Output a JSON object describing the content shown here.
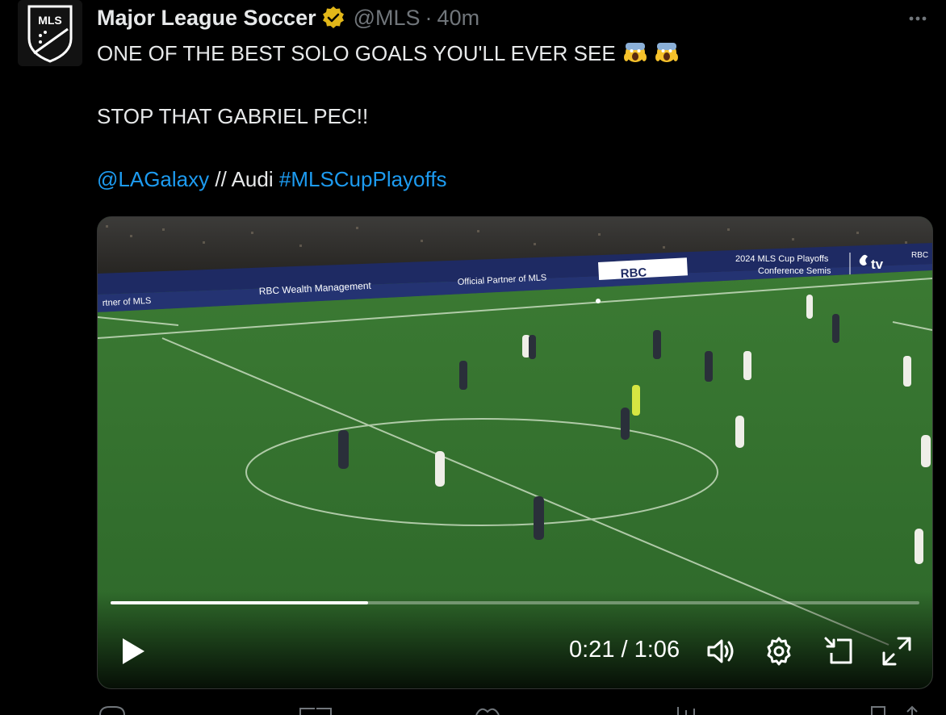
{
  "tweet": {
    "author_name": "Major League Soccer",
    "handle": "@MLS",
    "separator": "·",
    "time_ago": "40m",
    "line1": "ONE OF THE BEST SOLO GOALS YOU'LL EVER SEE",
    "line2": "STOP THAT GABRIEL PEC!!",
    "mention": "@LAGalaxy",
    "middle": " // Audi ",
    "hashtag": "#MLSCupPlayoffs",
    "avatar_logo": "MLS"
  },
  "video": {
    "current_time": "0:21",
    "duration": "1:06",
    "time_separator": " / ",
    "progress_fraction": 0.318,
    "overlay_top": "2024 MLS Cup Playoffs",
    "overlay_bottom": "Conference Semis",
    "overlay_brand": "tv",
    "board_rbc": "RBC Wealth Management",
    "board_partner": "Official Partner of MLS",
    "board_partner_left": "rtner of MLS",
    "board_rbc_logo": "RBC",
    "board_right": "RBC"
  },
  "icons": {
    "verified": "verified-badge-icon",
    "more": "more-icon",
    "play": "play-icon",
    "volume": "volume-icon",
    "settings": "gear-icon",
    "pip": "picture-in-picture-icon",
    "fullscreen": "fullscreen-icon",
    "emoji": "screaming-face-emoji"
  },
  "colors": {
    "background": "#000000",
    "link": "#1d9bf0",
    "muted": "#71767b",
    "verified_gold": "#e2b719",
    "pitch": "#2f6b2c"
  }
}
